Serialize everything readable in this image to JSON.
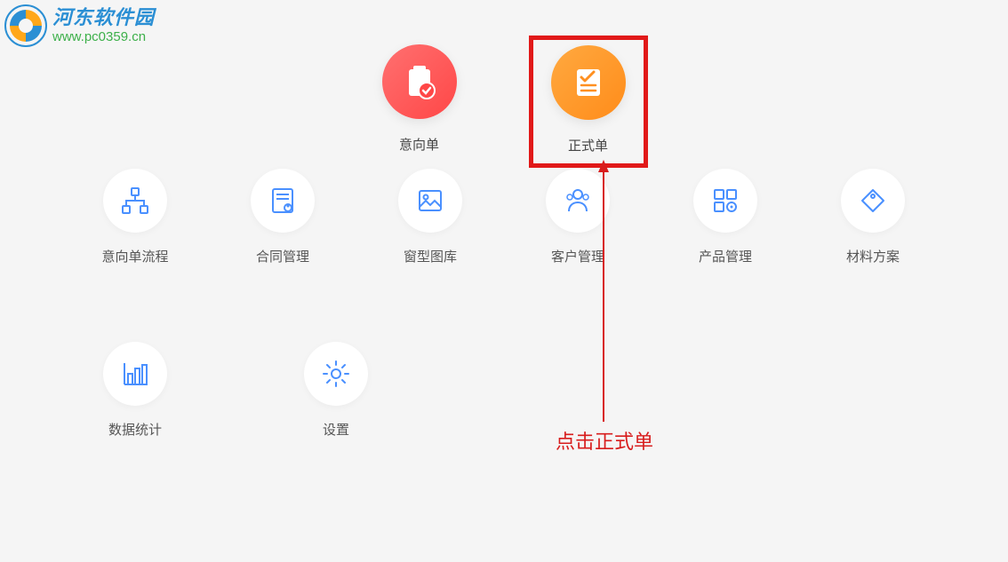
{
  "watermark": {
    "title": "河东软件园",
    "url": "www.pc0359.cn"
  },
  "top_items": [
    {
      "label": "意向单",
      "icon": "clipboard-check"
    },
    {
      "label": "正式单",
      "icon": "document-check",
      "highlighted": true
    }
  ],
  "grid_row2": [
    {
      "label": "意向单流程",
      "icon": "flow"
    },
    {
      "label": "合同管理",
      "icon": "contract"
    },
    {
      "label": "窗型图库",
      "icon": "image"
    },
    {
      "label": "客户管理",
      "icon": "customer"
    },
    {
      "label": "产品管理",
      "icon": "product"
    },
    {
      "label": "材料方案",
      "icon": "tag"
    }
  ],
  "grid_row3": [
    {
      "label": "数据统计",
      "icon": "chart"
    },
    {
      "label": "设置",
      "icon": "settings"
    }
  ],
  "annotation": {
    "text": "点击正式单"
  }
}
